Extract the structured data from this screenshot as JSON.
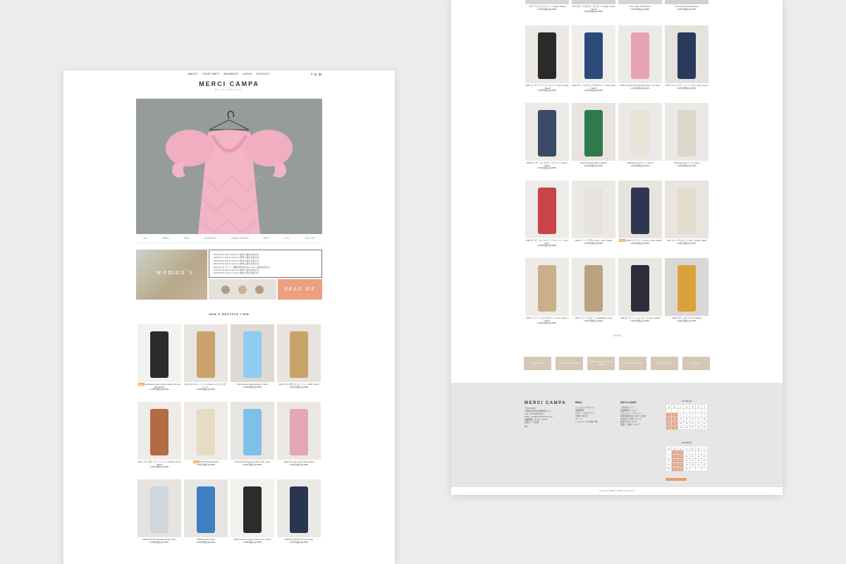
{
  "left": {
    "nav": [
      "ABOUT",
      "SHOP INFO",
      "WOMEN'S",
      "LOGIN",
      "CONTACT"
    ],
    "icons": [
      "facebook-icon",
      "instagram-icon",
      "cart-icon"
    ],
    "brand": "MERCI CAMPA",
    "tagline": "Mori & Kids & Co.",
    "categories": [
      "ALL",
      "BABY",
      "KIDS",
      "WOMEN'S",
      "HOME GOODS",
      "GIFT",
      "SALE",
      "OUTLET"
    ],
    "banner_text": "women's",
    "news": [
      "2023.03.24 kids & women's 新作入荷のお知らせ",
      "2023.03.17 kids & women's 新作入荷のお知らせ",
      "2023.03.10 kids & women's 新作入荷のお知らせ",
      "2023.03.03 kids & women's 新作入荷のお知らせ",
      "2023.02.25 アプリ・通販 新作のpickup new 入荷のお知らせ",
      "2023.02.18 kids & women's 新作入荷のお知らせ",
      "2023.02.11 women's & kids 新作入荷のお知らせ"
    ],
    "read_me": "READ ME",
    "new_heading": "NEW & RESTOCK ITEM",
    "products": [
      {
        "name": "1146 asymmetric volume pleats knit long skirt (black)",
        "price": "3,190円(税込み)SMPL",
        "badge": "NEW",
        "color": "#2b2b2b",
        "bg": "#f2f2f0"
      },
      {
        "name": "1841 ボンネット ハット (straw) キッズ ストローハット",
        "price": "3,190円(税込み)SMPL",
        "badge": "",
        "color": "#caa46c",
        "bg": "#e9e6e2"
      },
      {
        "name": "1145 hello knit beret (beige) / cherie",
        "price": "3,490円(税込み)SMPL",
        "badge": "",
        "color": "#8ecdf0",
        "bg": "#ded9d3"
      },
      {
        "name": "1148 リボン付き ストローハット (kids / adult)",
        "price": "3,190円(税込み)SMPL",
        "badge": "",
        "color": "#c9a46a",
        "bg": "#e7e3de"
      },
      {
        "name": "1165 リボン付き バケットハット (natural / brown / black)",
        "price": "3,190円(税込み)SMPL",
        "badge": "",
        "color": "#b36b45",
        "bg": "#efece8"
      },
      {
        "name": "1183 floral quilt jacket",
        "price": "3,490円(税込み)SMPL",
        "badge": "SALE",
        "color": "#e5dcc3",
        "bg": "#efece8"
      },
      {
        "name": "1179 tulle skirt layered pants / kids / gray",
        "price": "3,490円(税込み)SMPL",
        "badge": "",
        "color": "#7fc0e8",
        "bg": "#e7e5e2"
      },
      {
        "name": "1186 color line volume pants (kids)",
        "price": "3,490円(税込み)SMPL",
        "badge": "",
        "color": "#e4a7b4",
        "bg": "#ebe8e4"
      },
      {
        "name": "1056 check frill camisole (beige / blue)",
        "price": "3,490円(税込み)SMPL",
        "badge": "",
        "color": "#cfd6dd",
        "bg": "#e6e3df"
      },
      {
        "name": "1090 line track pants",
        "price": "3,490円(税込み)SMPL",
        "badge": "",
        "color": "#3f7fc4",
        "bg": "#e8e6e2"
      },
      {
        "name": "1060 bloomers romper pants (ivory / black)",
        "price": "3,490円(税込み)SMPL",
        "badge": "",
        "color": "#2c2c2c",
        "bg": "#f2f1ee"
      },
      {
        "name": "1078 big collar frill romper (navy)",
        "price": "3,490円(税込み)SMPL",
        "badge": "",
        "color": "#2a3550",
        "bg": "#ebe9e6"
      }
    ]
  },
  "right": {
    "top_products": [
      {
        "name": "1171 デニム ワイドパンツ (indigo / black)",
        "price": "3,490円(税込み)SMPL"
      },
      {
        "name": "1173 ポケット付きカーゴスカート (beige / green / black)",
        "price": "3,490円(税込み)SMPL"
      },
      {
        "name": "1174 cotton frill camisole",
        "price": "3,490円(税込み)SMPL"
      },
      {
        "name": "1172 collar frill knit pullover",
        "price": "3,490円(税込み)SMPL"
      }
    ],
    "products": [
      {
        "name": "1180 ストライプ テーパードパンツ (navy / beige / black)",
        "price": "3,490円(税込み)SMPL",
        "badge": "",
        "color": "#2a2a2a",
        "bg": "#ece9e4"
      },
      {
        "name": "1181 ポケット付き ロングサロペット (navy / blue / black)",
        "price": "3,490円(税込み)SMPL",
        "badge": "",
        "color": "#2c4a7a",
        "bg": "#f0eeea"
      },
      {
        "name": "1093 smocking frill camisole (pink / red / blue)",
        "price": "3,490円(税込み)SMPL",
        "badge": "",
        "color": "#e7a3b0",
        "bg": "#eceae6"
      },
      {
        "name": "1092 フリル カラー ニット ベスト (navy / ivory)",
        "price": "3,490円(税込み)SMPL",
        "badge": "",
        "color": "#2a3a5c",
        "bg": "#e5e2dd"
      },
      {
        "name": "1182 ボーダー ロングスリーブ Tシャツ (navy / black)",
        "price": "3,490円(税込み)SMPL",
        "badge": "",
        "color": "#3b4a66",
        "bg": "#eceae6"
      },
      {
        "name": "1121 big border fleece pullover",
        "price": "3,490円(税込み)SMPL",
        "badge": "",
        "color": "#2f7a4c",
        "bg": "#e7e4df"
      },
      {
        "name": "1130 logo long Tシャツ (ivory)",
        "price": "3,490円(税込み)SMPL",
        "badge": "",
        "color": "#e8e2d8",
        "bg": "#ebe9e6"
      },
      {
        "name": "1130 logo long Tシャツ (gray)",
        "price": "3,490円(税込み)SMPL",
        "badge": "",
        "color": "#ddd6cc",
        "bg": "#ebe9e6"
      },
      {
        "name": "1032 ボーダー ロングスリーブ カットソー (red / blue)",
        "price": "3,490円(税込み)SMPL",
        "badge": "",
        "color": "#c8434a",
        "bg": "#eeece9"
      },
      {
        "name": "1063 ドット ブラウス (ivory / gray / black)",
        "price": "3,490円(税込み)SMPL",
        "badge": "",
        "color": "#e6e2dc",
        "bg": "#ebe9e6"
      },
      {
        "name": "1066 フレア パンツ (ivory / navy / black)",
        "price": "3,490円(税込み)SMPL",
        "badge": "SALE",
        "color": "#2d3850",
        "bg": "#e7e4e0"
      },
      {
        "name": "1067 ワイド サロペット (ivory / khaki / black)",
        "price": "3,490円(税込み)SMPL",
        "badge": "",
        "color": "#e3dccf",
        "bg": "#e8e4de"
      },
      {
        "name": "1062 ティアード ロングスカート (ivory / beige / black)",
        "price": "3,490円(税込み)SMPL",
        "badge": "",
        "color": "#c9b08a",
        "bg": "#eeebe7"
      },
      {
        "name": "1061 プリーツ スカート (lightbeige / navy)",
        "price": "3,490円(税込み)SMPL",
        "badge": "",
        "color": "#b9a27e",
        "bg": "#ecebe8"
      },
      {
        "name": "1065 ロング ニット ワンピース (navy / black)",
        "price": "3,490円(税込み)SMPL",
        "badge": "",
        "color": "#2c2e3a",
        "bg": "#e9e7e3"
      },
      {
        "name": "1059 ラタン かごバッグ (natural)",
        "price": "3,490円(税込み)SMPL",
        "badge": "",
        "color": "#d9a23a",
        "bg": "#dad7d4"
      }
    ],
    "pagination": "1 2 3 4",
    "buttons": [
      "WOMEN'S",
      "BABY MERCHAN",
      "HOME GOODS GIFT ITEM",
      "KIDS MERCHAN",
      "FOR GIFT",
      "OUTLET"
    ],
    "footer": {
      "brand": "MERCI CAMPA",
      "address": [
        "〒530-0000",
        "大阪府大阪市北区梅田1-1-1",
        "TEL : 06-0000-0000",
        "MAIL : info@mercicampa.com",
        "営業時間 : 11:00 - 19:00",
        "定休日 : 不定休"
      ],
      "menu_title": "MENU",
      "menu": [
        "ショッピングガイド",
        "会員登録",
        "ログイン/ログアウト",
        "お問い合わせ",
        "カート",
        "ショッピング(お買い物)"
      ],
      "help_title": "HELP & GUIDE",
      "help": [
        "ご利用ガイド",
        "会員規約について",
        "プライバシーポリシー",
        "特定商取引法に基づく表記",
        "お支払い方法について",
        "配送方法について",
        "返品・交換について"
      ],
      "cal1_title": "2023年4月",
      "cal2_title": "2023年5月",
      "weekdays": [
        "日",
        "月",
        "火",
        "水",
        "木",
        "金",
        "土"
      ],
      "copyright": "copyright © MERCI CAMPA all reserved."
    }
  }
}
